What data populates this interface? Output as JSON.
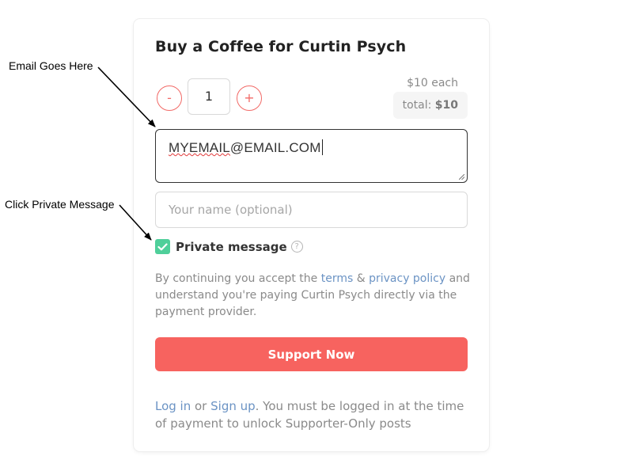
{
  "annotations": {
    "email_note": "Email Goes Here",
    "private_note": "Click Private Message"
  },
  "card": {
    "title": "Buy a Coffee for Curtin Psych",
    "quantity": {
      "minus_label": "-",
      "value": "1",
      "plus_label": "+"
    },
    "price": {
      "each": "$10 each",
      "total_label": "total:",
      "total_value": "$10"
    },
    "email_field": {
      "value_misspelled": "MYEMAIL",
      "value_rest": "@EMAIL.COM"
    },
    "name_field": {
      "placeholder": "Your name (optional)"
    },
    "private_message": {
      "checked": true,
      "label": "Private message",
      "help_glyph": "?"
    },
    "legal": {
      "text_1": "By continuing you accept the ",
      "terms_link": "terms",
      "text_2": " & ",
      "privacy_link": "privacy policy",
      "text_3": " and understand you're paying Curtin Psych directly via the payment provider."
    },
    "support_button": "Support Now",
    "login_note": {
      "login_link": "Log in",
      "text_1": " or ",
      "signup_link": "Sign up",
      "text_2": ". You must be logged in at the time of payment to unlock Supporter-Only posts"
    }
  },
  "colors": {
    "accent": "#f7635f",
    "checkbox": "#4fcf9a",
    "link": "#6b93c4"
  }
}
